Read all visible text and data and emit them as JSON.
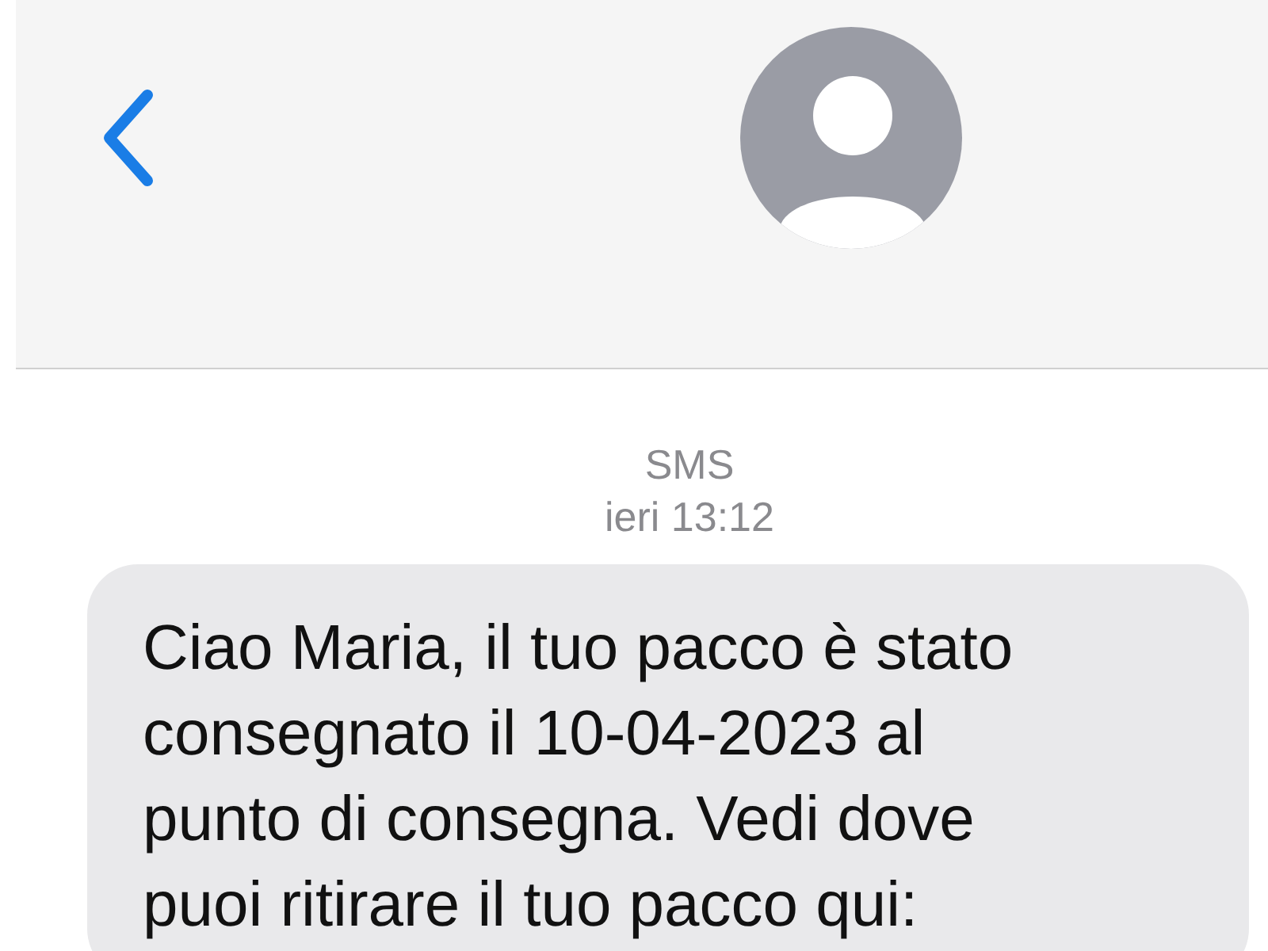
{
  "thread": {
    "service": "SMS",
    "time": "ieri 13:12"
  },
  "messages": [
    {
      "kind": "incoming",
      "text": "Ciao Maria, il tuo pacco è stato\nconsegnato il 10-04-2023 al\npunto di consegna. Vedi dove\npuoi ritirare il tuo pacco qui:"
    }
  ]
}
